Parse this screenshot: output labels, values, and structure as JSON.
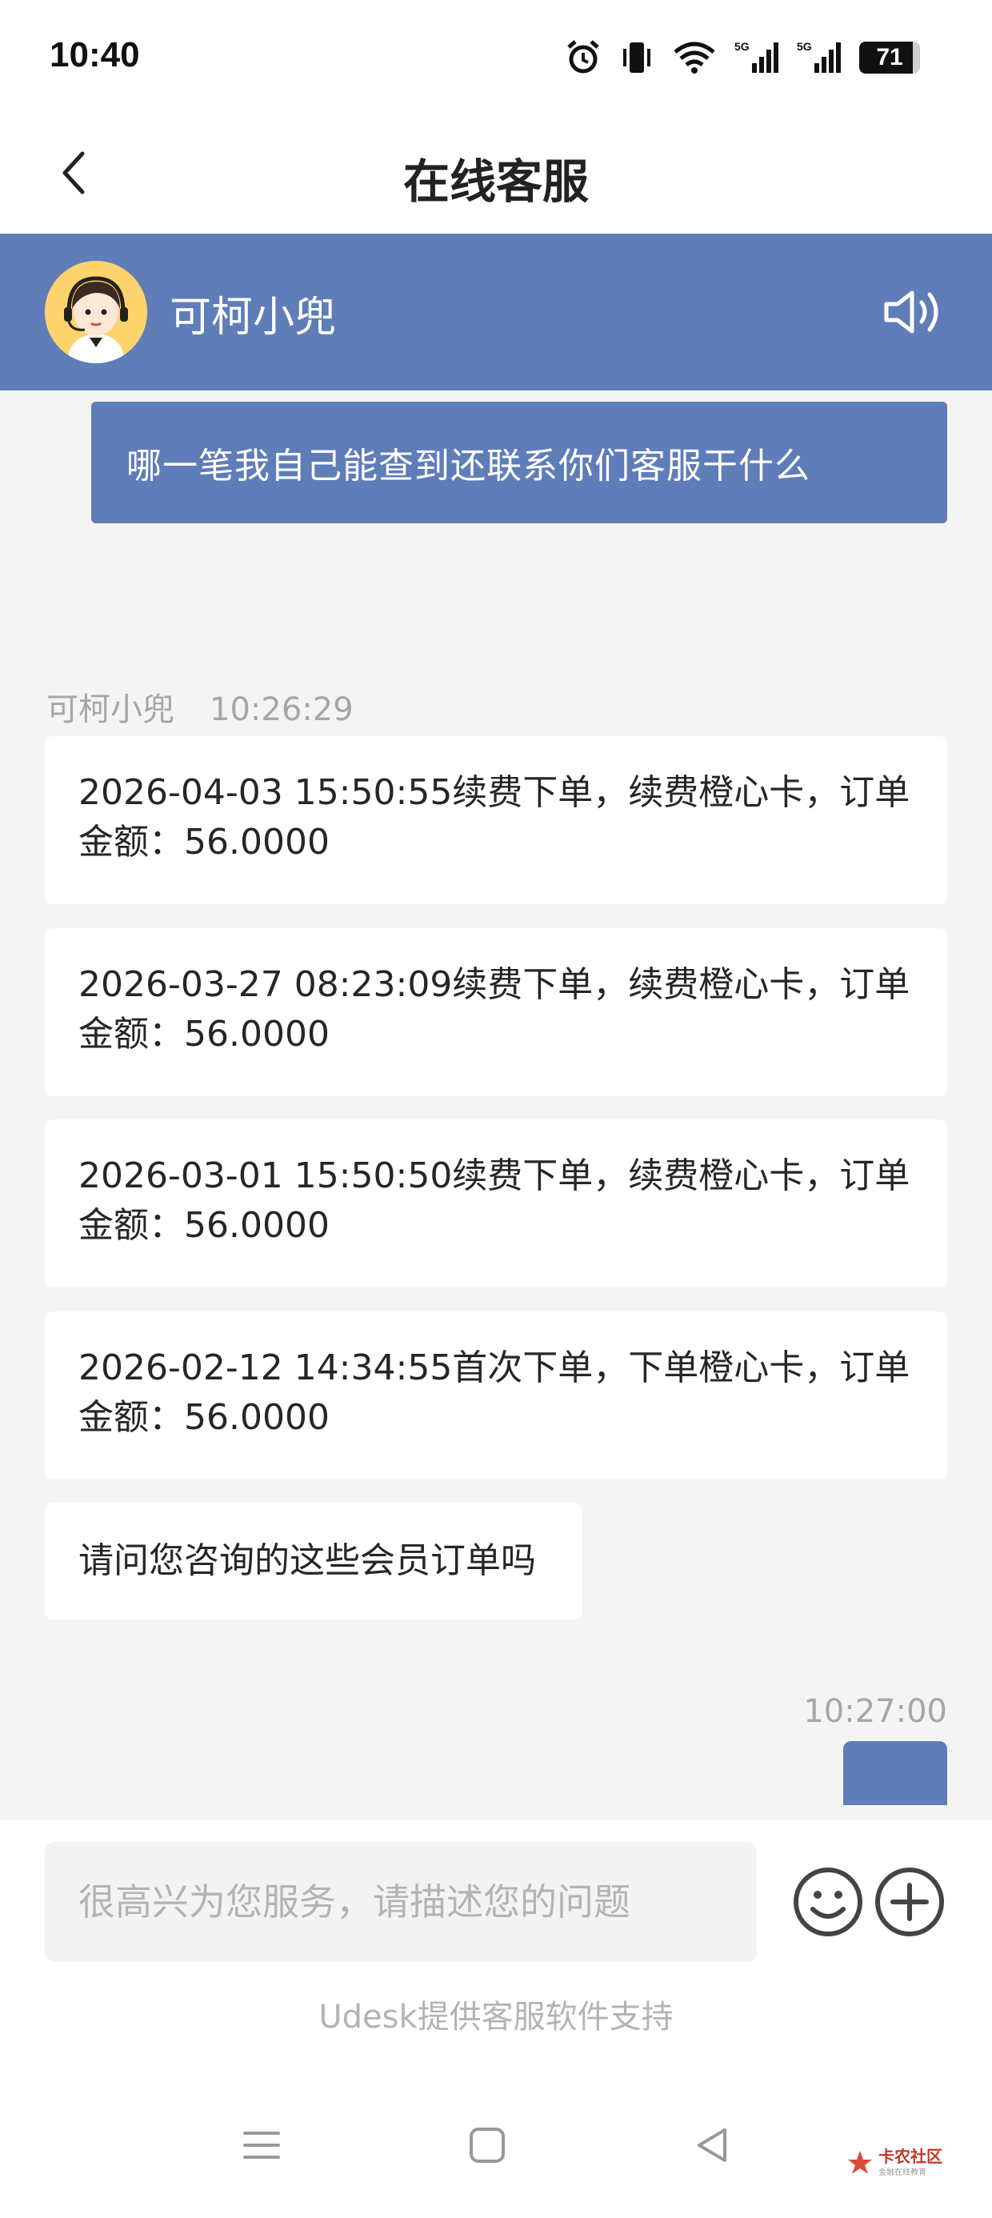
{
  "status_bar": {
    "time": "10:40",
    "battery": "71",
    "icons": [
      "alarm-icon",
      "vibrate-icon",
      "wifi-icon",
      "signal-5g-icon",
      "signal-5g-icon",
      "battery-icon"
    ]
  },
  "header": {
    "title": "在线客服",
    "back_icon": "chevron-left-icon"
  },
  "agent": {
    "name": "可柯小兜",
    "speaker_icon": "speaker-icon",
    "bar_color": "#5f7db8"
  },
  "messages": {
    "user_message_1": "哪一笔我自己能查到还联系你们客服干什么",
    "agent_sender": "可柯小兜",
    "agent_time": "10:26:29",
    "orders": [
      {
        "line1": "2026-04-03 15:50:55续费下单，续费橙心卡，订单",
        "line2": "金额：56.0000"
      },
      {
        "line1": "2026-03-27 08:23:09续费下单，续费橙心卡，订单",
        "line2": "金额：56.0000"
      },
      {
        "line1": "2026-03-01 15:50:50续费下单，续费橙心卡，订单",
        "line2": "金额：56.0000"
      },
      {
        "line1": "2026-02-12 14:34:55首次下单，下单橙心卡，订单",
        "line2": "金额：56.0000"
      }
    ],
    "agent_question": "请问您咨询的这些会员订单吗",
    "user_time_2": "10:27:00"
  },
  "input": {
    "placeholder": "很高兴为您服务，请描述您的问题",
    "value": ""
  },
  "footer": {
    "powered_by": "Udesk提供客服软件支持"
  },
  "watermark": {
    "text": "卡农社区",
    "sub": "金融在线教育"
  }
}
